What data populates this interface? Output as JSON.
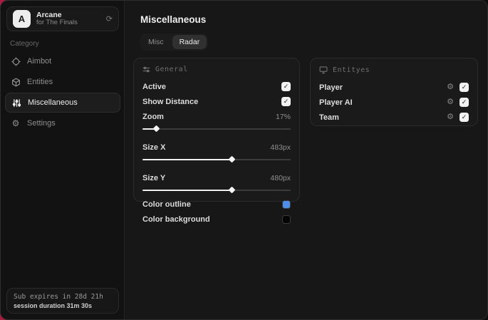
{
  "app": {
    "logo_letter": "A",
    "title": "Arcane",
    "subtitle": "for The Finals"
  },
  "icons": {
    "check": "✓",
    "gear": "⚙",
    "refresh": "⟳"
  },
  "sidebar": {
    "category_label": "Category",
    "items": [
      {
        "label": "Aimbot"
      },
      {
        "label": "Entities"
      },
      {
        "label": "Miscellaneous"
      },
      {
        "label": "Settings"
      }
    ],
    "footer": {
      "line1": "Sub expires in 28d 21h",
      "line2": "session duration 31m 30s"
    }
  },
  "main": {
    "title": "Miscellaneous",
    "tabs": [
      {
        "label": "Misc",
        "active": false
      },
      {
        "label": "Radar",
        "active": true
      }
    ]
  },
  "general_panel": {
    "title": "General",
    "active": {
      "label": "Active",
      "checked": true
    },
    "show_distance": {
      "label": "Show Distance",
      "checked": true
    },
    "zoom": {
      "label": "Zoom",
      "value": "17%",
      "percent": 9
    },
    "size_x": {
      "label": "Size X",
      "value": "483px",
      "percent": 60
    },
    "size_y": {
      "label": "Size Y",
      "value": "480px",
      "percent": 60
    },
    "color_outline": {
      "label": "Color outline",
      "color": "#4e8ee8"
    },
    "color_background": {
      "label": "Color background",
      "color": "#050505"
    }
  },
  "entities_panel": {
    "title": "Entityes",
    "rows": [
      {
        "label": "Player",
        "checked": true
      },
      {
        "label": "Player AI",
        "checked": true
      },
      {
        "label": "Team",
        "checked": true
      }
    ]
  },
  "colors": {
    "backdrop_red": "#a81c42",
    "accent_blue": "#4e8ee8",
    "panel_bg": "#1a1a1a",
    "sidebar_bg": "#121212"
  }
}
